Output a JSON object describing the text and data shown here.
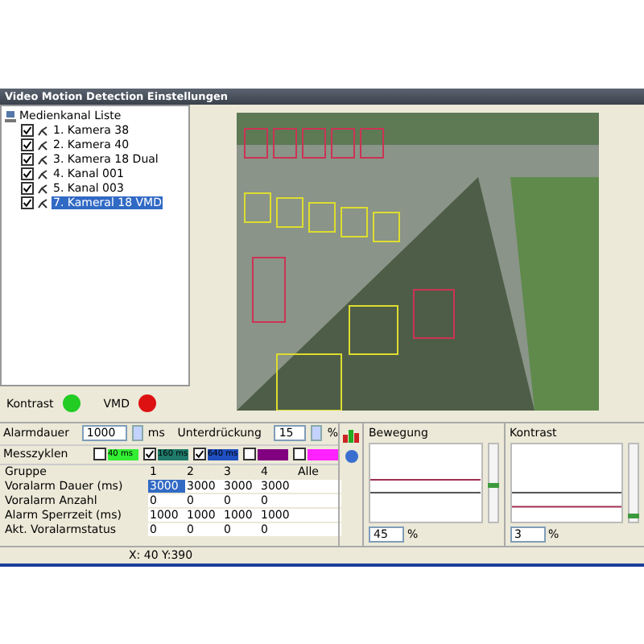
{
  "window": {
    "title": "Video Motion Detection Einstellungen"
  },
  "tree": {
    "root": "Medienkanal Liste",
    "children": [
      {
        "label": "1. Kamera 38",
        "checked": true,
        "selected": false
      },
      {
        "label": "2. Kamera 40",
        "checked": true,
        "selected": false
      },
      {
        "label": "3. Kamera 18 Dual",
        "checked": true,
        "selected": false
      },
      {
        "label": "4. Kanal 001",
        "checked": true,
        "selected": false
      },
      {
        "label": "5. Kanal 003",
        "checked": true,
        "selected": false
      },
      {
        "label": "7. Kameral 18 VMD",
        "checked": true,
        "selected": true
      }
    ]
  },
  "indicators": [
    {
      "label": "Kontrast",
      "color": "#22cc22"
    },
    {
      "label": "VMD",
      "color": "#dd1111"
    }
  ],
  "alarmdauer": {
    "label": "Alarmdauer",
    "value": "1000",
    "unit": "ms"
  },
  "unterdrueckung": {
    "label": "Unterdrückung",
    "value": "15",
    "unit": "%"
  },
  "messzyklen": {
    "label": "Messzyklen",
    "items": [
      {
        "label": "40 ms",
        "checked": false,
        "color": "#33ee33"
      },
      {
        "label": "160 ms",
        "checked": true,
        "color": "#1f7a6a"
      },
      {
        "label": "640 ms",
        "checked": true,
        "color": "#1f4fc0"
      },
      {
        "checked": false,
        "color": "#800080"
      },
      {
        "checked": false,
        "color": "#ff22ff"
      }
    ]
  },
  "table": {
    "corner": "Gruppe",
    "columns": [
      "1",
      "2",
      "3",
      "4",
      "Alle"
    ],
    "rows": [
      {
        "label": "Voralarm Dauer (ms)",
        "cells": [
          {
            "value": "3000",
            "selected": true
          },
          {
            "value": "3000",
            "selected": false
          },
          {
            "value": "3000",
            "selected": false
          },
          {
            "value": "3000",
            "selected": false
          }
        ]
      },
      {
        "label": "Voralarm Anzahl",
        "cells": [
          {
            "value": "0",
            "selected": false
          },
          {
            "value": "0",
            "selected": false
          },
          {
            "value": "0",
            "selected": false
          },
          {
            "value": "0",
            "selected": false
          }
        ]
      },
      {
        "label": "Alarm Sperrzeit (ms)",
        "cells": [
          {
            "value": "1000",
            "selected": false
          },
          {
            "value": "1000",
            "selected": false
          },
          {
            "value": "1000",
            "selected": false
          },
          {
            "value": "1000",
            "selected": false
          }
        ]
      },
      {
        "label": "Akt. Voralarmstatus",
        "cells": [
          {
            "value": "0",
            "selected": false
          },
          {
            "value": "0",
            "selected": false
          },
          {
            "value": "0",
            "selected": false
          },
          {
            "value": "0",
            "selected": false
          }
        ]
      }
    ]
  },
  "meters": [
    {
      "title": "Bewegung",
      "level": 0.45,
      "value": "45",
      "unit": "%"
    },
    {
      "title": "Kontrast",
      "level": 0.03,
      "value": "3",
      "unit": "%"
    }
  ],
  "status_bar": "X: 40 Y:390"
}
